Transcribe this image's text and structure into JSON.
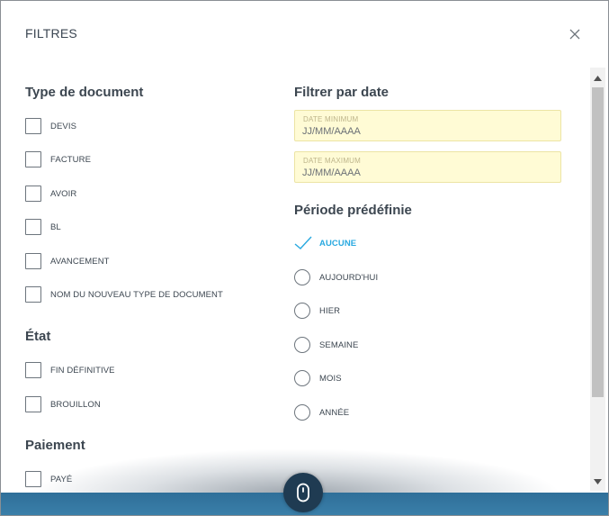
{
  "dialog": {
    "title": "FILTRES"
  },
  "document_type": {
    "title": "Type de document",
    "options": [
      {
        "label": "DEVIS",
        "checked": false
      },
      {
        "label": "FACTURE",
        "checked": false
      },
      {
        "label": "AVOIR",
        "checked": false
      },
      {
        "label": "BL",
        "checked": false
      },
      {
        "label": "AVANCEMENT",
        "checked": false
      },
      {
        "label": "NOM DU NOUVEAU TYPE DE DOCUMENT",
        "checked": false
      }
    ]
  },
  "state": {
    "title": "État",
    "options": [
      {
        "label": "FIN DÉFINITIVE",
        "checked": false
      },
      {
        "label": "BROUILLON",
        "checked": false
      }
    ]
  },
  "payment": {
    "title": "Paiement",
    "options": [
      {
        "label": "PAYÉ",
        "checked": false
      }
    ]
  },
  "date_filter": {
    "title": "Filtrer par date",
    "min": {
      "label": "DATE MINIMUM",
      "placeholder": "JJ/MM/AAAA",
      "value": ""
    },
    "max": {
      "label": "DATE MAXIMUM",
      "placeholder": "JJ/MM/AAAA",
      "value": ""
    }
  },
  "period": {
    "title": "Période prédéfinie",
    "selected": "AUCUNE",
    "options": [
      {
        "label": "AUCUNE"
      },
      {
        "label": "AUJOURD'HUI"
      },
      {
        "label": "HIER"
      },
      {
        "label": "SEMAINE"
      },
      {
        "label": "MOIS"
      },
      {
        "label": "ANNÉE"
      }
    ]
  },
  "colors": {
    "accent": "#29a9e0",
    "date_field_bg": "#fffbd5",
    "bottom_bar": "#3a7fa9"
  },
  "icons": {
    "close": "close-icon",
    "scroll_hint": "mouse-scroll-icon",
    "selected_mark": "checkmark-icon"
  }
}
